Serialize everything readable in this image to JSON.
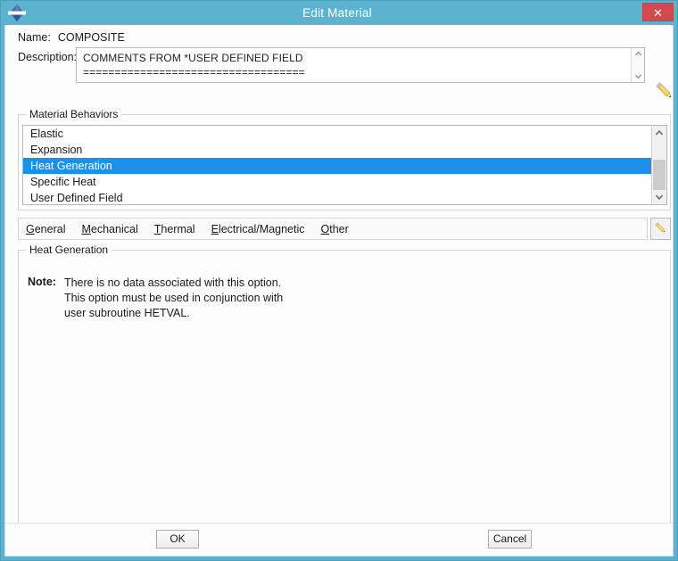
{
  "window": {
    "title": "Edit Material",
    "icon": "abaqus-diamond-icon",
    "close_label": "✕",
    "titlebar_color": "#5bb3cf",
    "close_color": "#d14b4b",
    "accent_color": "#1e90e8"
  },
  "name": {
    "label": "Name:",
    "value": "COMPOSITE"
  },
  "description": {
    "label": "Description:",
    "value": "COMMENTS FROM *USER DEFINED FIELD\n===================================",
    "placeholder": "",
    "edit_icon": "pencil-icon"
  },
  "behaviors": {
    "group_title": "Material Behaviors",
    "items": [
      {
        "label": "Elastic",
        "selected": false
      },
      {
        "label": "Expansion",
        "selected": false
      },
      {
        "label": "Heat Generation",
        "selected": true
      },
      {
        "label": "Specific Heat",
        "selected": false
      },
      {
        "label": "User Defined Field",
        "selected": false
      }
    ],
    "scrollbar": {
      "up_glyph": "˄",
      "down_glyph": "˅"
    }
  },
  "menubar": {
    "items": [
      {
        "mnemonic": "G",
        "rest": "eneral"
      },
      {
        "mnemonic": "M",
        "rest": "echanical"
      },
      {
        "mnemonic": "T",
        "rest": "hermal"
      },
      {
        "mnemonic": "E",
        "rest": "lectrical/Magnetic"
      },
      {
        "mnemonic": "O",
        "rest": "ther"
      }
    ],
    "edit_icon": "pencil-icon"
  },
  "detail": {
    "group_title": "Heat Generation",
    "note_label": "Note:",
    "note_lines": [
      "There is no data associated with this option.",
      "This option must be used in conjunction with",
      "user subroutine HETVAL."
    ]
  },
  "footer": {
    "ok_label": "OK",
    "cancel_label": "Cancel"
  }
}
